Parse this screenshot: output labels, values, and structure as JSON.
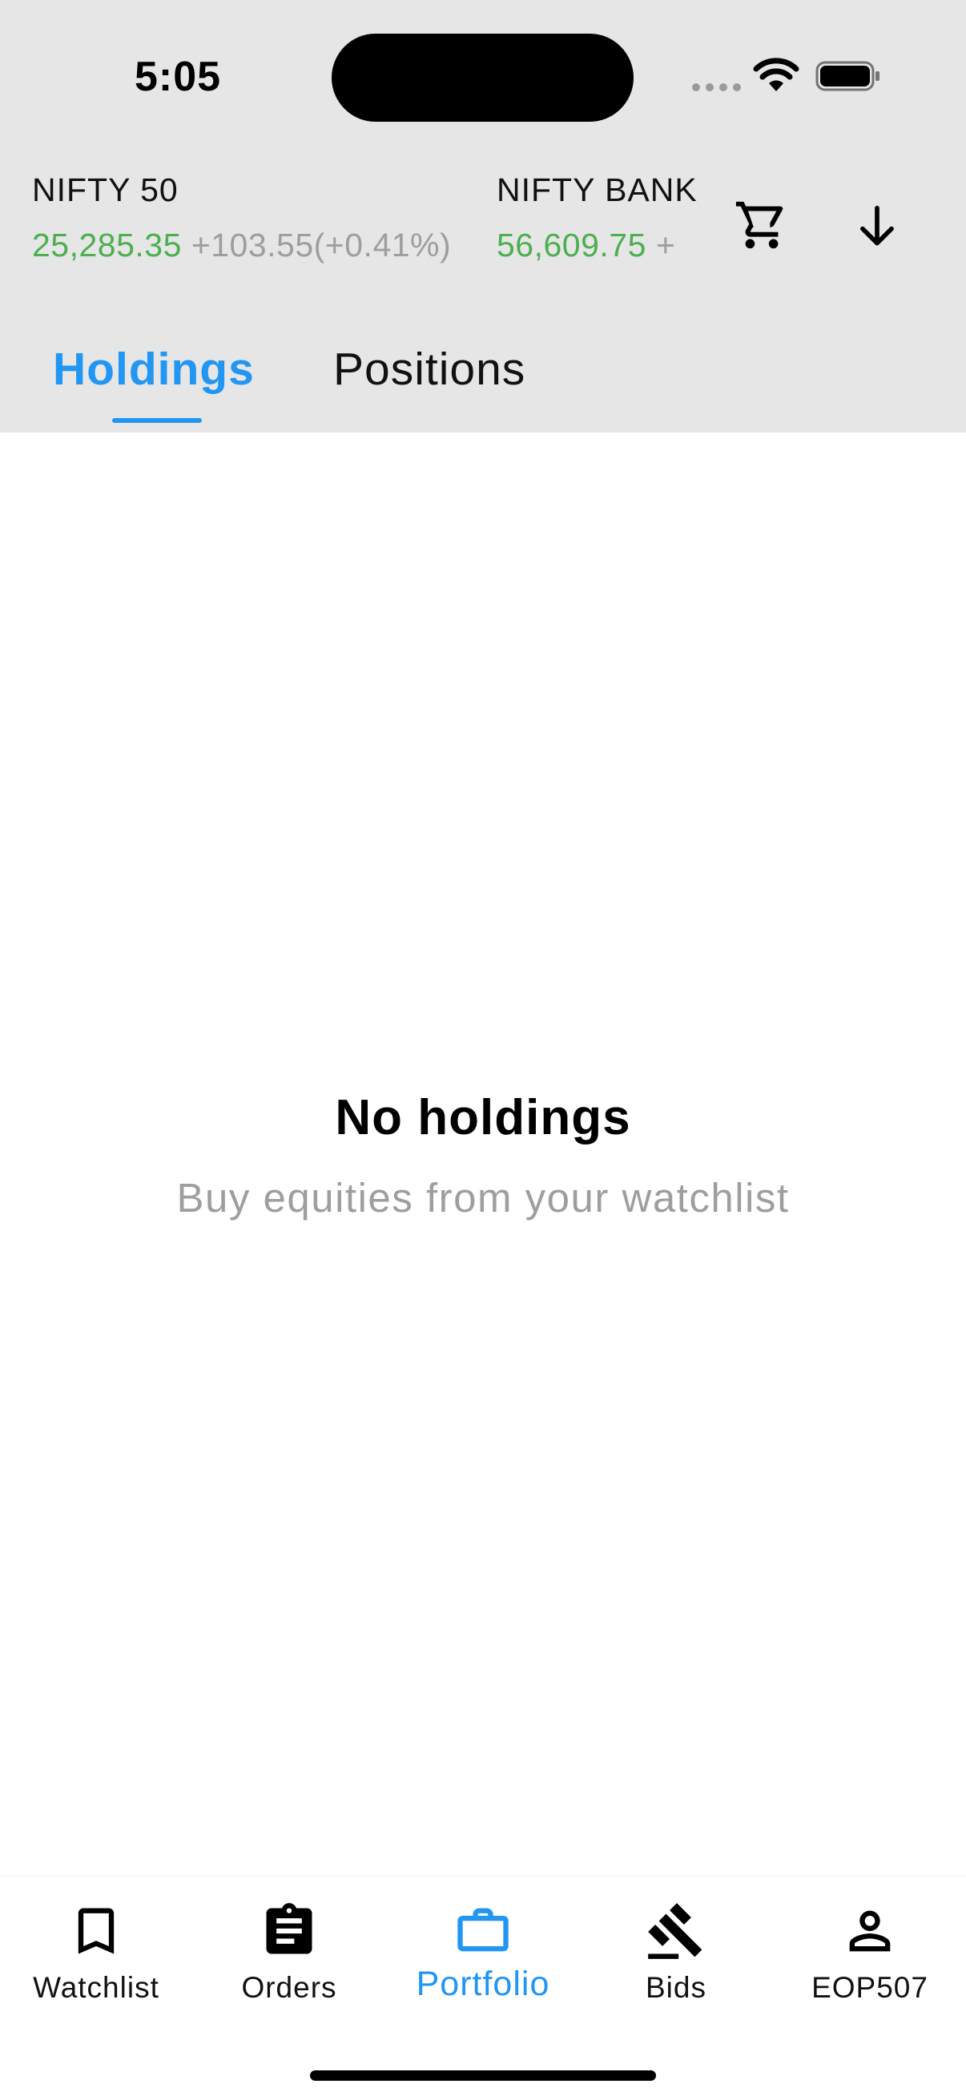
{
  "status_bar": {
    "time": "5:05"
  },
  "ticker": {
    "indices": [
      {
        "name": "NIFTY 50",
        "price": "25,285.35",
        "change": "+103.55(+0.41%)"
      },
      {
        "name": "NIFTY BANK",
        "price": "56,609.75",
        "change": "+"
      }
    ],
    "cart_icon": "shopping-cart-icon",
    "expand_icon": "arrow-down-icon"
  },
  "tabs": [
    {
      "label": "Holdings",
      "active": true
    },
    {
      "label": "Positions",
      "active": false
    }
  ],
  "empty_state": {
    "title": "No holdings",
    "subtitle": "Buy equities from your watchlist"
  },
  "bottom_nav": [
    {
      "label": "Watchlist",
      "icon": "bookmark-icon",
      "active": false
    },
    {
      "label": "Orders",
      "icon": "clipboard-icon",
      "active": false
    },
    {
      "label": "Portfolio",
      "icon": "briefcase-icon",
      "active": true
    },
    {
      "label": "Bids",
      "icon": "gavel-icon",
      "active": false
    },
    {
      "label": "EOP507",
      "icon": "person-icon",
      "active": false
    }
  ],
  "colors": {
    "accent": "#2196f3",
    "positive": "#4caf50",
    "muted": "#9e9e9e",
    "header_bg": "#e6e6e6"
  }
}
